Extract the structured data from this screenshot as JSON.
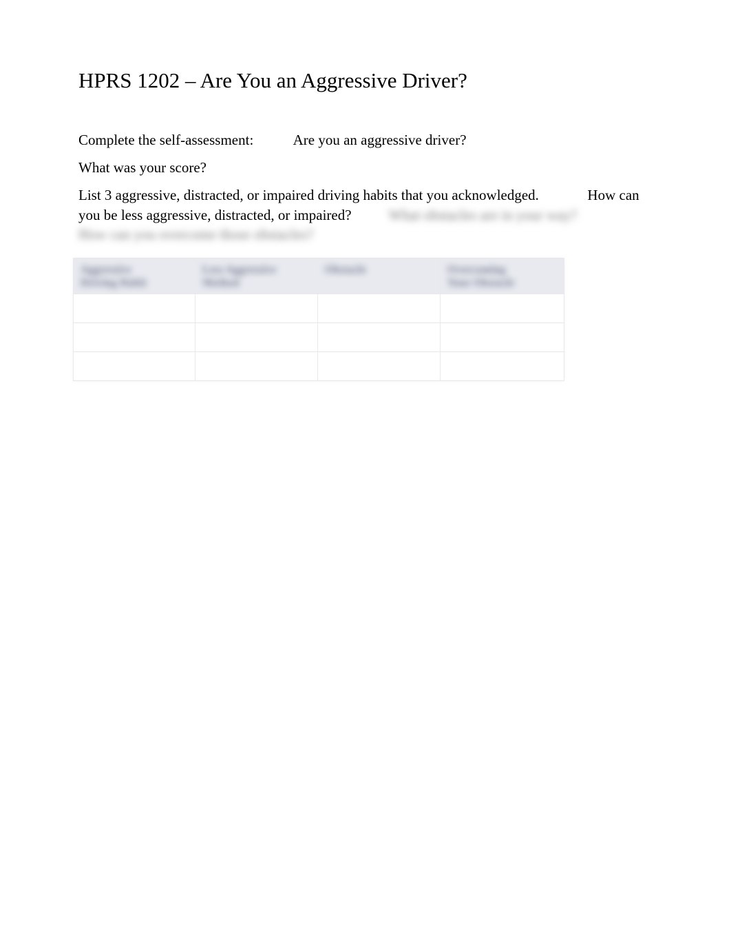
{
  "title": "HPRS 1202 – Are You an Aggressive Driver?",
  "intro": {
    "assessment_label": "Complete the self-assessment:",
    "assessment_value": "Are you an aggressive driver?",
    "score_prompt": "What was your score?"
  },
  "instructions": {
    "part1": "List 3 aggressive, distracted, or impaired driving habits that you acknowledged.",
    "part2": "How can you be less aggressive, distracted, or impaired?",
    "hidden1": "What obstacles are in your way?",
    "hidden2": "How can you overcome those obstacles?"
  },
  "table": {
    "headers": [
      "Aggressive\nDriving Habit",
      "Less Aggressive\nMethod",
      "Obstacle",
      "Overcoming\nYour Obstacle"
    ],
    "rows": [
      [
        "",
        "",
        "",
        ""
      ],
      [
        "",
        "",
        "",
        ""
      ],
      [
        "",
        "",
        "",
        ""
      ]
    ]
  }
}
